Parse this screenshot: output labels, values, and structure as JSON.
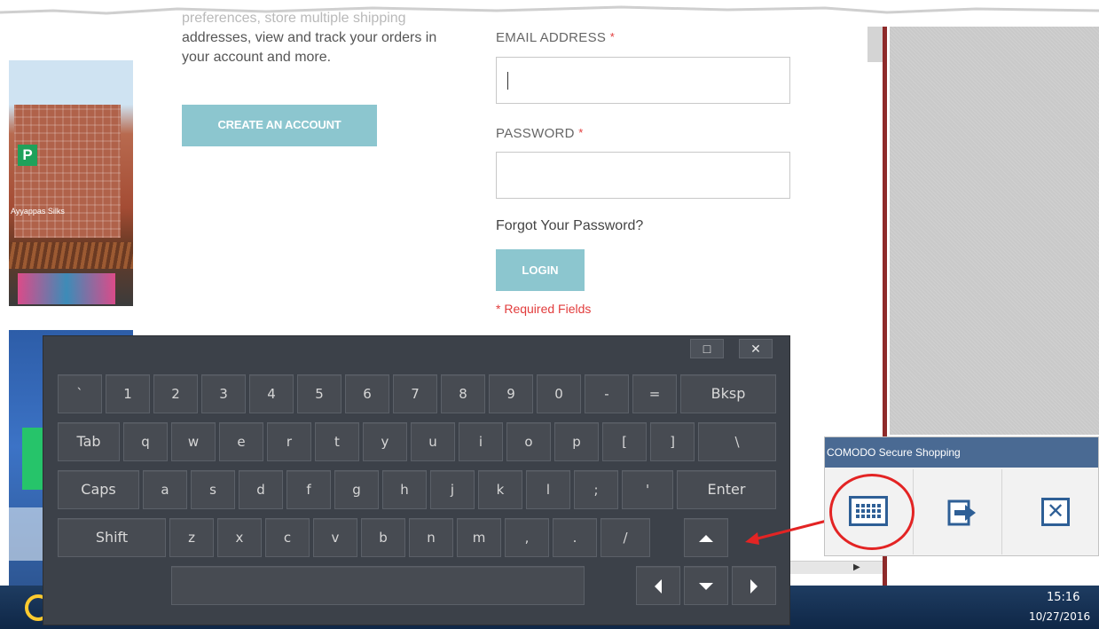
{
  "page": {
    "intro_faded": "preferences, store multiple shipping",
    "intro_line1": "addresses, view and track your orders in",
    "intro_line2": "your account and more.",
    "create_account_label": "CREATE AN ACCOUNT",
    "thumb_sign": "Ayyappas Silks",
    "email_label": "EMAIL ADDRESS",
    "password_label": "PASSWORD",
    "required_mark": "*",
    "forgot_password": "Forgot Your Password?",
    "login_label": "LOGIN",
    "required_fields": "* Required Fields"
  },
  "keyboard": {
    "maximize_icon": "□",
    "close_icon": "✕",
    "row1": [
      "`",
      "1",
      "2",
      "3",
      "4",
      "5",
      "6",
      "7",
      "8",
      "9",
      "0",
      "-",
      "=",
      "Bksp"
    ],
    "row2": [
      "Tab",
      "q",
      "w",
      "e",
      "r",
      "t",
      "y",
      "u",
      "i",
      "o",
      "p",
      "[",
      "]",
      "\\"
    ],
    "row3": [
      "Caps",
      "a",
      "s",
      "d",
      "f",
      "g",
      "h",
      "j",
      "k",
      "l",
      ";",
      "'",
      "Enter"
    ],
    "row4": [
      "Shift",
      "z",
      "x",
      "c",
      "v",
      "b",
      "n",
      "m",
      ",",
      ".",
      "/"
    ]
  },
  "comodo": {
    "title": "COMODO Secure Shopping",
    "buttons": [
      "keyboard-icon",
      "sign-out-icon",
      "close-icon"
    ]
  },
  "taskbar": {
    "time": "15:16",
    "date": "10/27/2016"
  },
  "colors": {
    "button_teal": "#8cc6cf",
    "required_red": "#e23c3c",
    "keyboard_bg": "#3c4149",
    "comodo_blue": "#4a6a93",
    "highlight_red": "#e32424"
  }
}
